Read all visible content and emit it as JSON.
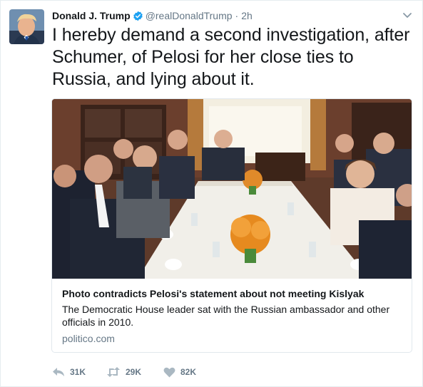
{
  "tweet": {
    "author_name": "Donald J. Trump",
    "author_handle": "@realDonaldTrump",
    "separator": "·",
    "timestamp": "2h",
    "text": "I hereby demand a second investigation, after Schumer, of Pelosi for her close ties to Russia, and lying about it."
  },
  "card": {
    "title": "Photo contradicts Pelosi's statement about not meeting Kislyak",
    "description": "The Democratic House leader sat with the Russian ambassador and other officials in 2010.",
    "domain": "politico.com"
  },
  "actions": {
    "replies": "31K",
    "retweets": "29K",
    "likes": "82K"
  },
  "icons": {
    "verified": "verified-badge-icon",
    "caret": "chevron-down-icon",
    "reply": "reply-icon",
    "retweet": "retweet-icon",
    "like": "heart-icon"
  },
  "colors": {
    "verified_blue": "#1da1f2",
    "secondary_text": "#657786",
    "primary_text": "#14171a",
    "border": "#e1e8ed"
  }
}
